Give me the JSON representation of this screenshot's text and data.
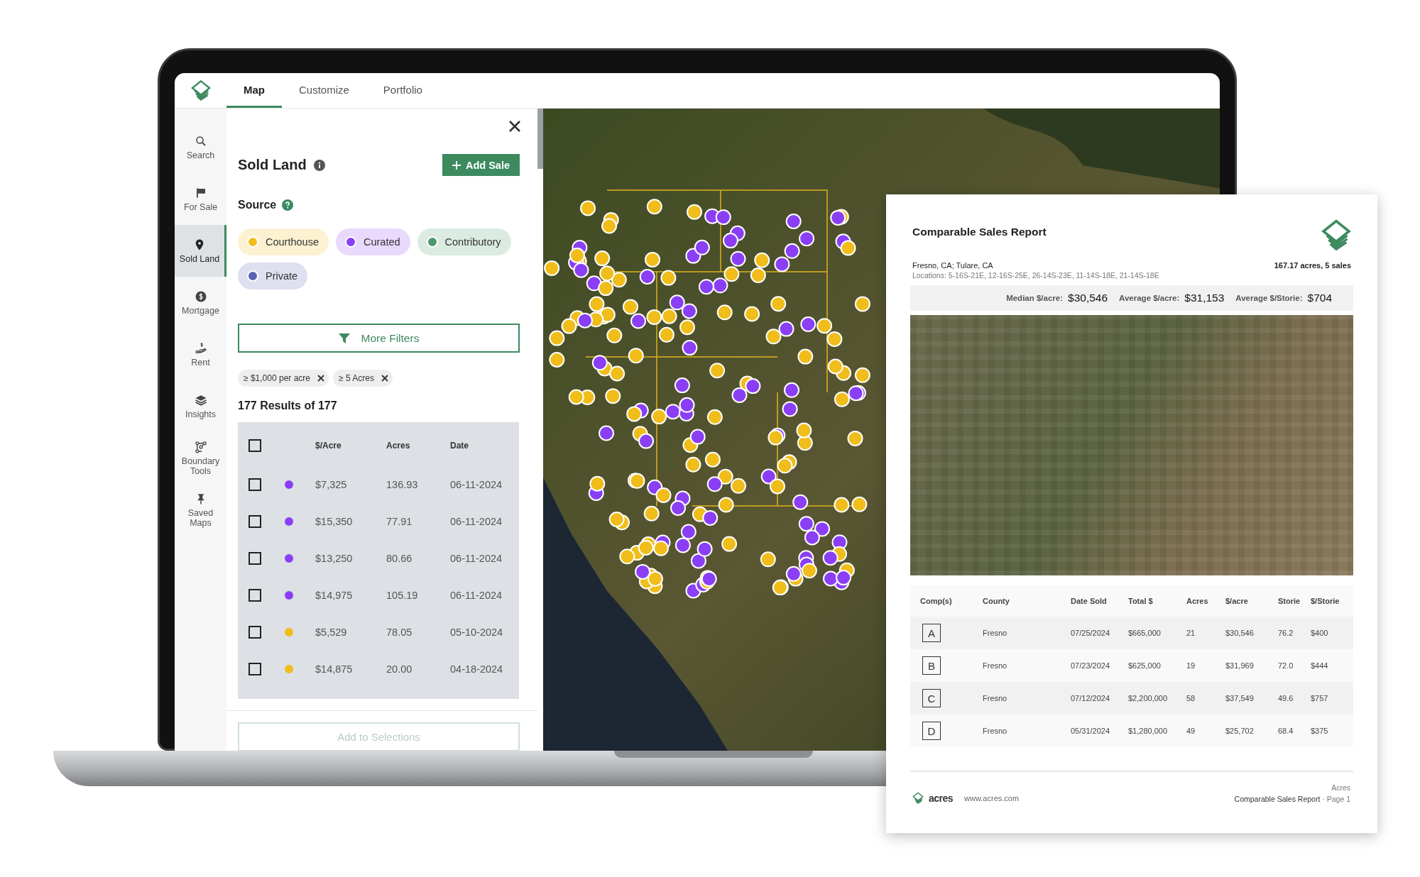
{
  "app": {
    "tabs": [
      {
        "label": "Map",
        "selected": true
      },
      {
        "label": "Customize",
        "selected": false
      },
      {
        "label": "Portfolio",
        "selected": false
      }
    ],
    "sidebar": [
      {
        "label": "Search",
        "selected": false
      },
      {
        "label": "For Sale",
        "selected": false
      },
      {
        "label": "Sold Land",
        "selected": true
      },
      {
        "label": "Mortgage",
        "selected": false
      },
      {
        "label": "Rent",
        "selected": false
      },
      {
        "label": "Insights",
        "selected": false
      },
      {
        "label": "Boundary Tools",
        "selected": false
      },
      {
        "label": "Saved Maps",
        "selected": false
      }
    ]
  },
  "panel": {
    "title": "Sold Land",
    "add_button": "Add Sale",
    "source_label": "Source",
    "sources": [
      {
        "label": "Courthouse",
        "color": "#f0bd1b"
      },
      {
        "label": "Curated",
        "color": "#8a3ff5"
      },
      {
        "label": "Contributory",
        "color": "#4c9a6c"
      },
      {
        "label": "Private",
        "color": "#5b62b5"
      }
    ],
    "more_filters": "More Filters",
    "filter_chips": [
      "≥ $1,000 per acre",
      "≥ 5 Acres"
    ],
    "results": "177 Results of 177",
    "table": {
      "all_checked": false,
      "columns": [
        "$/Acre",
        "Acres",
        "Date"
      ],
      "rows": [
        {
          "checked": false,
          "color": "#8a3ff5",
          "price": "$7,325",
          "acres": "136.93",
          "date": "06-11-2024"
        },
        {
          "checked": false,
          "color": "#8a3ff5",
          "price": "$15,350",
          "acres": "77.91",
          "date": "06-11-2024"
        },
        {
          "checked": false,
          "color": "#8a3ff5",
          "price": "$13,250",
          "acres": "80.66",
          "date": "06-11-2024"
        },
        {
          "checked": false,
          "color": "#8a3ff5",
          "price": "$14,975",
          "acres": "105.19",
          "date": "06-11-2024"
        },
        {
          "checked": false,
          "color": "#f0bd1b",
          "price": "$5,529",
          "acres": "78.05",
          "date": "05-10-2024"
        },
        {
          "checked": false,
          "color": "#f0bd1b",
          "price": "$14,875",
          "acres": "20.00",
          "date": "04-18-2024"
        }
      ]
    },
    "add_to_selections": {
      "label": "Add to Selections",
      "disabled": true
    }
  },
  "report": {
    "title": "Comparable Sales Report",
    "counties": "Fresno, CA; Tulare, CA",
    "locations": "Locations: 5-16S-21E, 12-16S-25E, 26-14S-23E, 11-14S-18E, 21-14S-18E",
    "summary": "167.17 acres, 5 sales",
    "stats": [
      {
        "label": "Median $/acre:",
        "value": "$30,546"
      },
      {
        "label": "Average $/acre:",
        "value": "$31,153"
      },
      {
        "label": "Average $/Storie:",
        "value": "$704"
      }
    ],
    "table": {
      "columns": [
        "Comp(s)",
        "County",
        "Date Sold",
        "Total $",
        "Acres",
        "$/acre",
        "Storie",
        "$/Storie"
      ],
      "rows": [
        [
          "A",
          "Fresno",
          "07/25/2024",
          "$665,000",
          "21",
          "$30,546",
          "76.2",
          "$400"
        ],
        [
          "B",
          "Fresno",
          "07/23/2024",
          "$625,000",
          "19",
          "$31,969",
          "72.0",
          "$444"
        ],
        [
          "C",
          "Fresno",
          "07/12/2024",
          "$2,200,000",
          "58",
          "$37,549",
          "49.6",
          "$757"
        ],
        [
          "D",
          "Fresno",
          "05/31/2024",
          "$1,280,000",
          "49",
          "$25,702",
          "68.4",
          "$375"
        ]
      ]
    },
    "footer": {
      "brand": "acres",
      "url": "www.acres.com",
      "company": "Acres",
      "report_name": "Comparable Sales Report",
      "separator": "·",
      "page": "Page 1"
    }
  }
}
